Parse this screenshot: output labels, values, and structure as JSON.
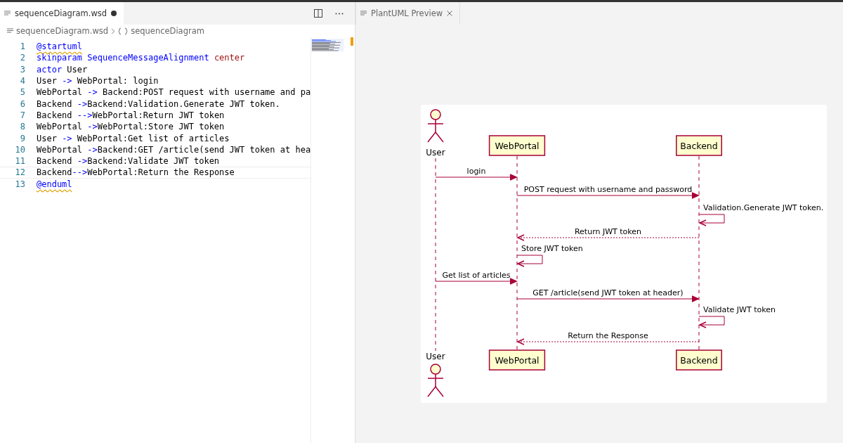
{
  "editor": {
    "tab": {
      "title": "sequenceDiagram.wsd",
      "modified": true,
      "selected": true
    },
    "breadcrumb": [
      {
        "text": "sequenceDiagram.wsd",
        "kind": "file"
      },
      {
        "text": "sequenceDiagram",
        "kind": "symbol"
      }
    ],
    "lines": [
      {
        "number": "1",
        "current": false,
        "tokens": [
          {
            "text": "@startuml",
            "kind": "directive"
          }
        ]
      },
      {
        "number": "2",
        "current": false,
        "tokens": [
          {
            "text": "skinparam SequenceMessageAlignment ",
            "kind": "keyword"
          },
          {
            "text": "center",
            "kind": "value"
          }
        ]
      },
      {
        "number": "3",
        "current": false,
        "tokens": [
          {
            "text": "actor ",
            "kind": "keyword"
          },
          {
            "text": "User",
            "kind": "plain"
          }
        ]
      },
      {
        "number": "4",
        "current": false,
        "tokens": [
          {
            "text": "User ",
            "kind": "plain"
          },
          {
            "text": "->",
            "kind": "arrow"
          },
          {
            "text": " WebPortal: login",
            "kind": "plain"
          }
        ]
      },
      {
        "number": "5",
        "current": false,
        "tokens": [
          {
            "text": "WebPortal ",
            "kind": "plain"
          },
          {
            "text": "->",
            "kind": "arrow"
          },
          {
            "text": " Backend:POST request with username and pa",
            "kind": "plain"
          }
        ]
      },
      {
        "number": "6",
        "current": false,
        "tokens": [
          {
            "text": "Backend ",
            "kind": "plain"
          },
          {
            "text": "->",
            "kind": "arrow"
          },
          {
            "text": "Backend:Validation.Generate JWT token.",
            "kind": "plain"
          }
        ]
      },
      {
        "number": "7",
        "current": false,
        "tokens": [
          {
            "text": "Backend ",
            "kind": "plain"
          },
          {
            "text": "-->",
            "kind": "arrow"
          },
          {
            "text": "WebPortal:Return JWT token",
            "kind": "plain"
          }
        ]
      },
      {
        "number": "8",
        "current": false,
        "tokens": [
          {
            "text": "WebPortal ",
            "kind": "plain"
          },
          {
            "text": "->",
            "kind": "arrow"
          },
          {
            "text": "WebPortal:Store JWT token",
            "kind": "plain"
          }
        ]
      },
      {
        "number": "9",
        "current": false,
        "tokens": [
          {
            "text": "User ",
            "kind": "plain"
          },
          {
            "text": "->",
            "kind": "arrow"
          },
          {
            "text": " WebPortal:Get list of articles",
            "kind": "plain"
          }
        ]
      },
      {
        "number": "10",
        "current": false,
        "tokens": [
          {
            "text": "WebPortal ",
            "kind": "plain"
          },
          {
            "text": "->",
            "kind": "arrow"
          },
          {
            "text": "Backend:GET /article(send JWT token at hea",
            "kind": "plain"
          }
        ]
      },
      {
        "number": "11",
        "current": false,
        "tokens": [
          {
            "text": "Backend ",
            "kind": "plain"
          },
          {
            "text": "->",
            "kind": "arrow"
          },
          {
            "text": "Backend:Validate JWT token",
            "kind": "plain"
          }
        ]
      },
      {
        "number": "12",
        "current": true,
        "tokens": [
          {
            "text": "Backend",
            "kind": "plain"
          },
          {
            "text": "-->",
            "kind": "arrow"
          },
          {
            "text": "WebPortal:Return the Response",
            "kind": "plain"
          }
        ]
      },
      {
        "number": "13",
        "current": false,
        "tokens": [
          {
            "text": "@enduml",
            "kind": "directive"
          }
        ]
      }
    ]
  },
  "preview": {
    "tab": {
      "title": "PlantUML Preview",
      "selected": false
    },
    "diagram": {
      "top_participants": [
        {
          "name": "User",
          "kind": "actor"
        },
        {
          "name": "WebPortal",
          "kind": "participant"
        },
        {
          "name": "Backend",
          "kind": "participant"
        }
      ],
      "messages": [
        {
          "label": "login",
          "kind": "user_to_portal"
        },
        {
          "label": "POST request with username and password",
          "kind": "portal_to_backend"
        },
        {
          "label": "Validation.Generate JWT token.",
          "kind": "backend_self"
        },
        {
          "label": "Return JWT token",
          "kind": "backend_return_to_portal"
        },
        {
          "label": "Store JWT token",
          "kind": "portal_self"
        },
        {
          "label": "Get list of articles",
          "kind": "user_to_portal"
        },
        {
          "label": "GET /article(send JWT token at header)",
          "kind": "portal_to_backend"
        },
        {
          "label": "Validate JWT token",
          "kind": "backend_self"
        },
        {
          "label": "Return the Response",
          "kind": "backend_return_to_portal"
        }
      ],
      "bottom_participants": [
        {
          "name": "User",
          "kind": "actor"
        },
        {
          "name": "WebPortal",
          "kind": "participant"
        },
        {
          "name": "Backend",
          "kind": "participant"
        }
      ]
    }
  }
}
